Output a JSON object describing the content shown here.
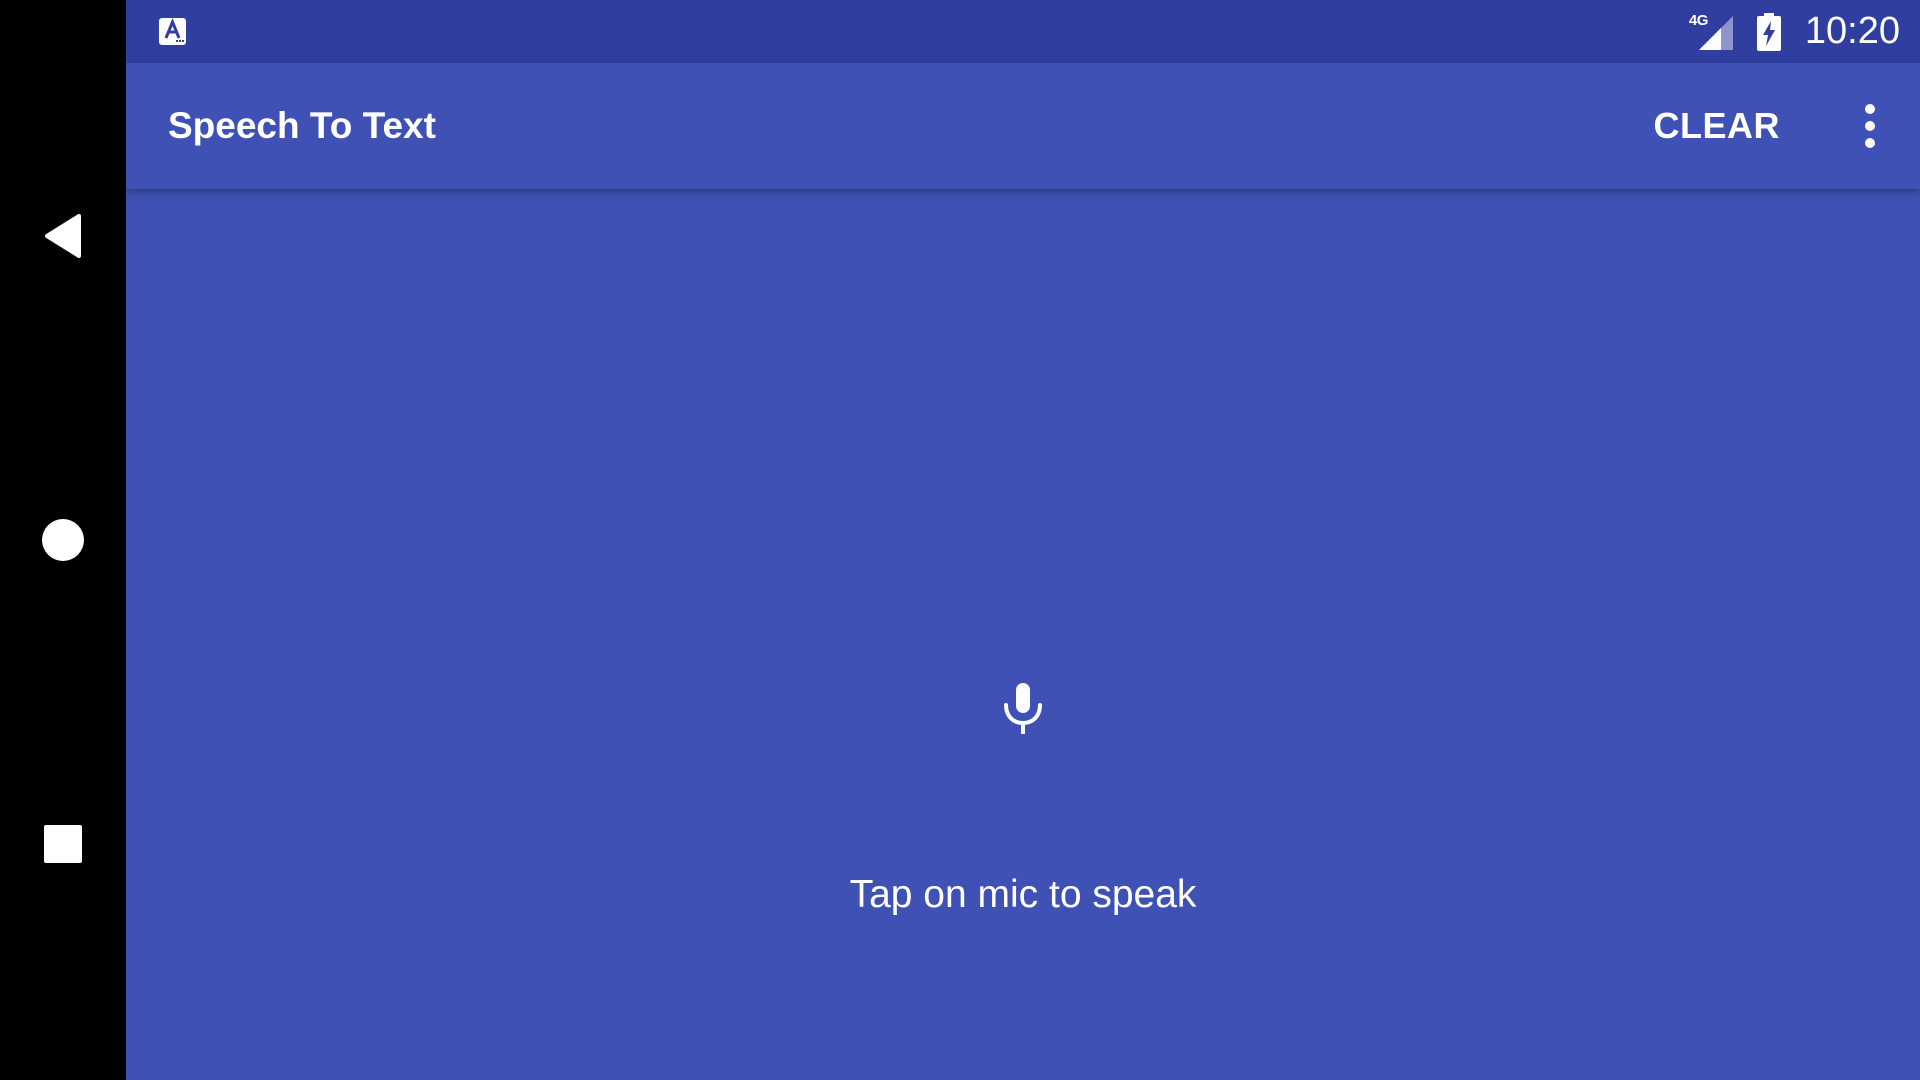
{
  "status_bar": {
    "network_type": "4G",
    "time": "10:20",
    "notification_icon": "text-a-icon",
    "signal_icon": "cell-signal-icon",
    "battery_icon": "battery-charging-icon"
  },
  "nav_bar": {
    "back_icon": "back-triangle-icon",
    "home_icon": "home-circle-icon",
    "recents_icon": "recents-square-icon"
  },
  "toolbar": {
    "title": "Speech To Text",
    "clear_label": "CLEAR",
    "overflow_icon": "more-vert-icon"
  },
  "main": {
    "mic_icon": "microphone-icon",
    "hint_text": "Tap on mic to speak"
  },
  "colors": {
    "primary": "#3f51b5",
    "primary_dark": "#303f9f",
    "nav_bar": "#000000",
    "text": "#ffffff"
  }
}
